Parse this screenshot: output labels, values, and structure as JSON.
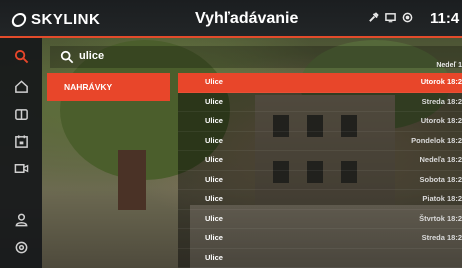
{
  "status_bar": {
    "brand": "SKYLINK",
    "title": "Vyhľadávanie",
    "clock": "11:4",
    "icons": [
      "tools-icon",
      "tv-icon",
      "record-icon"
    ]
  },
  "rail": {
    "items": [
      {
        "icon": "search-icon",
        "active": true
      },
      {
        "icon": "home-icon",
        "active": false
      },
      {
        "icon": "book-icon",
        "active": false
      },
      {
        "icon": "calendar-icon",
        "active": false
      },
      {
        "icon": "camera-icon",
        "active": false
      },
      {
        "icon": "user-icon",
        "active": false
      },
      {
        "icon": "settings-icon",
        "active": false
      }
    ],
    "accent": "#e8462a"
  },
  "search": {
    "query": "ulice"
  },
  "category": {
    "label": "NAHRÁVKY"
  },
  "results": {
    "header_when": "Nedeľ 1",
    "rows": [
      {
        "name": "Ulice",
        "when": "Utorok 18:2",
        "selected": true
      },
      {
        "name": "Ulice",
        "when": "Streda 18:2",
        "selected": false
      },
      {
        "name": "Ulice",
        "when": "Utorok 18:2",
        "selected": false
      },
      {
        "name": "Ulice",
        "when": "Pondelok 18:2",
        "selected": false
      },
      {
        "name": "Ulice",
        "when": "Nedeľa 18:2",
        "selected": false
      },
      {
        "name": "Ulice",
        "when": "Sobota 18:2",
        "selected": false
      },
      {
        "name": "Ulice",
        "when": "Piatok 18:2",
        "selected": false
      },
      {
        "name": "Ulice",
        "when": "Štvrtok 18:2",
        "selected": false
      },
      {
        "name": "Ulice",
        "when": "Streda 18:2",
        "selected": false
      },
      {
        "name": "Ulice",
        "when": "",
        "selected": false
      }
    ]
  }
}
